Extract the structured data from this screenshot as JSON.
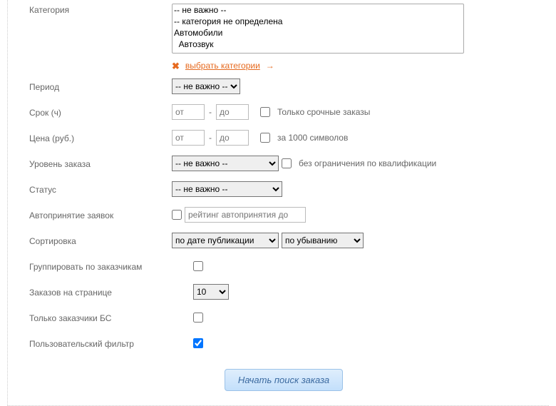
{
  "labels": {
    "category": "Категория",
    "period": "Период",
    "deadline": "Срок (ч)",
    "price": "Цена (руб.)",
    "level": "Уровень заказа",
    "status": "Статус",
    "autoaccept": "Автопринятие заявок",
    "sorting": "Сортировка",
    "group": "Группировать по заказчикам",
    "per_page": "Заказов на странице",
    "only_bs": "Только заказчики БС",
    "user_filter": "Пользовательский фильтр"
  },
  "category_options": [
    "-- не важно --",
    "-- категория не определена",
    "Автомобили",
    "  Автозвук"
  ],
  "select_categories_link": "выбрать категории",
  "period": {
    "selected": "-- не важно --",
    "options": [
      "-- не важно --"
    ]
  },
  "deadline": {
    "from_placeholder": "от",
    "to_placeholder": "до",
    "urgent_label": "Только срочные заказы",
    "urgent_checked": false
  },
  "price": {
    "from_placeholder": "от",
    "to_placeholder": "до",
    "per1000_label": "за 1000 символов",
    "per1000_checked": false
  },
  "level": {
    "selected": "-- не важно --",
    "options": [
      "-- не важно --"
    ],
    "noqual_label": "без ограничения по квалификации",
    "noqual_checked": false
  },
  "status": {
    "selected": "-- не важно --",
    "options": [
      "-- не важно --"
    ]
  },
  "autoaccept": {
    "checked": false,
    "rating_placeholder": "рейтинг автопринятия до"
  },
  "sorting": {
    "field": {
      "selected": "по дате публикации",
      "options": [
        "по дате публикации"
      ]
    },
    "dir": {
      "selected": "по убыванию",
      "options": [
        "по убыванию"
      ]
    }
  },
  "group_checked": false,
  "per_page": {
    "selected": "10",
    "options": [
      "10"
    ]
  },
  "only_bs_checked": false,
  "user_filter_checked": true,
  "submit_label": "Начать поиск заказа"
}
